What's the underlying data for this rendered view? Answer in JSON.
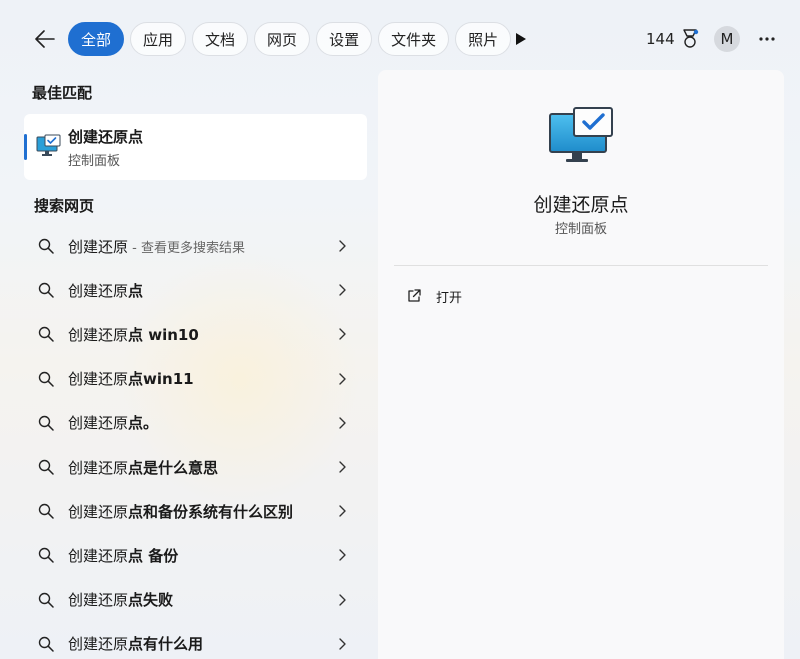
{
  "header": {
    "tabs": [
      {
        "label": "全部",
        "active": true
      },
      {
        "label": "应用",
        "active": false
      },
      {
        "label": "文档",
        "active": false
      },
      {
        "label": "网页",
        "active": false
      },
      {
        "label": "设置",
        "active": false
      },
      {
        "label": "文件夹",
        "active": false
      },
      {
        "label": "照片",
        "active": false
      }
    ],
    "points": "144",
    "avatar_initial": "M"
  },
  "best_match": {
    "section_title": "最佳匹配",
    "title": "创建还原点",
    "subtitle": "控制面板"
  },
  "web_search": {
    "section_title": "搜索网页",
    "results": [
      {
        "query": "创建还原",
        "bold": "",
        "hint": " - 查看更多搜索结果"
      },
      {
        "query": "创建还原",
        "bold": "点",
        "hint": ""
      },
      {
        "query": "创建还原",
        "bold": "点 win10",
        "hint": ""
      },
      {
        "query": "创建还原",
        "bold": "点win11",
        "hint": ""
      },
      {
        "query": "创建还原",
        "bold": "点。",
        "hint": ""
      },
      {
        "query": "创建还原",
        "bold": "点是什么意思",
        "hint": ""
      },
      {
        "query": "创建还原",
        "bold": "点和备份系统有什么区别",
        "hint": ""
      },
      {
        "query": "创建还原",
        "bold": "点 备份",
        "hint": ""
      },
      {
        "query": "创建还原",
        "bold": "点失败",
        "hint": ""
      },
      {
        "query": "创建还原",
        "bold": "点有什么用",
        "hint": ""
      }
    ]
  },
  "detail": {
    "title": "创建还原点",
    "subtitle": "控制面板",
    "actions": [
      {
        "label": "打开",
        "icon": "open-external-icon"
      }
    ]
  },
  "colors": {
    "accent": "#1f6fd1"
  }
}
